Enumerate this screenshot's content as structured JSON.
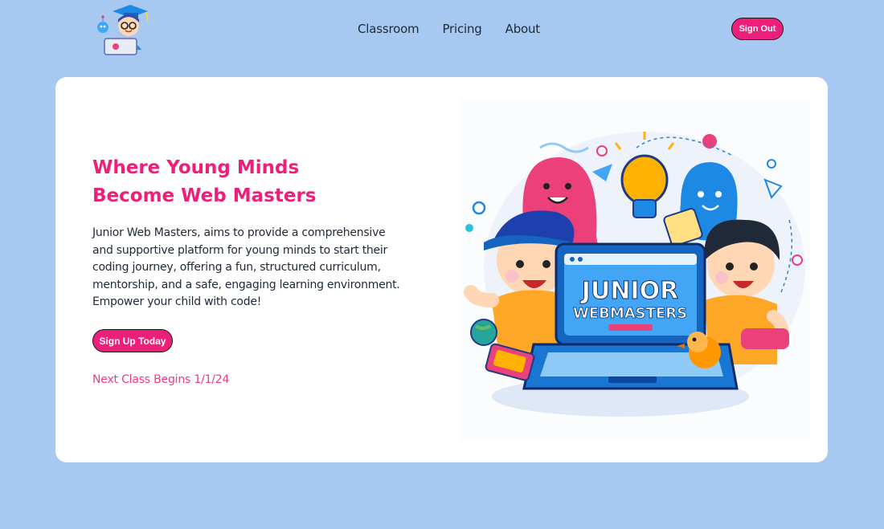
{
  "nav": {
    "links": [
      "Classroom",
      "Pricing",
      "About"
    ],
    "sign_out": "Sign Out"
  },
  "hero": {
    "title_line1": "Where Young Minds",
    "title_line2": "Become Web Masters",
    "description": "Junior Web Masters, aims to provide a comprehensive and supportive platform for young minds to start their coding journey, offering a fun, structured curriculum, mentorship, and a safe, engaging learning environment. Empower your child with code!",
    "cta": "Sign Up Today",
    "next_class": "Next Class Begins 1/1/24",
    "illustration": {
      "line1": "JUNIOR",
      "line2": "WEBMASTERS"
    }
  },
  "colors": {
    "background": "#a7c8f0",
    "accent": "#ee1f7a",
    "card": "#ffffff"
  }
}
